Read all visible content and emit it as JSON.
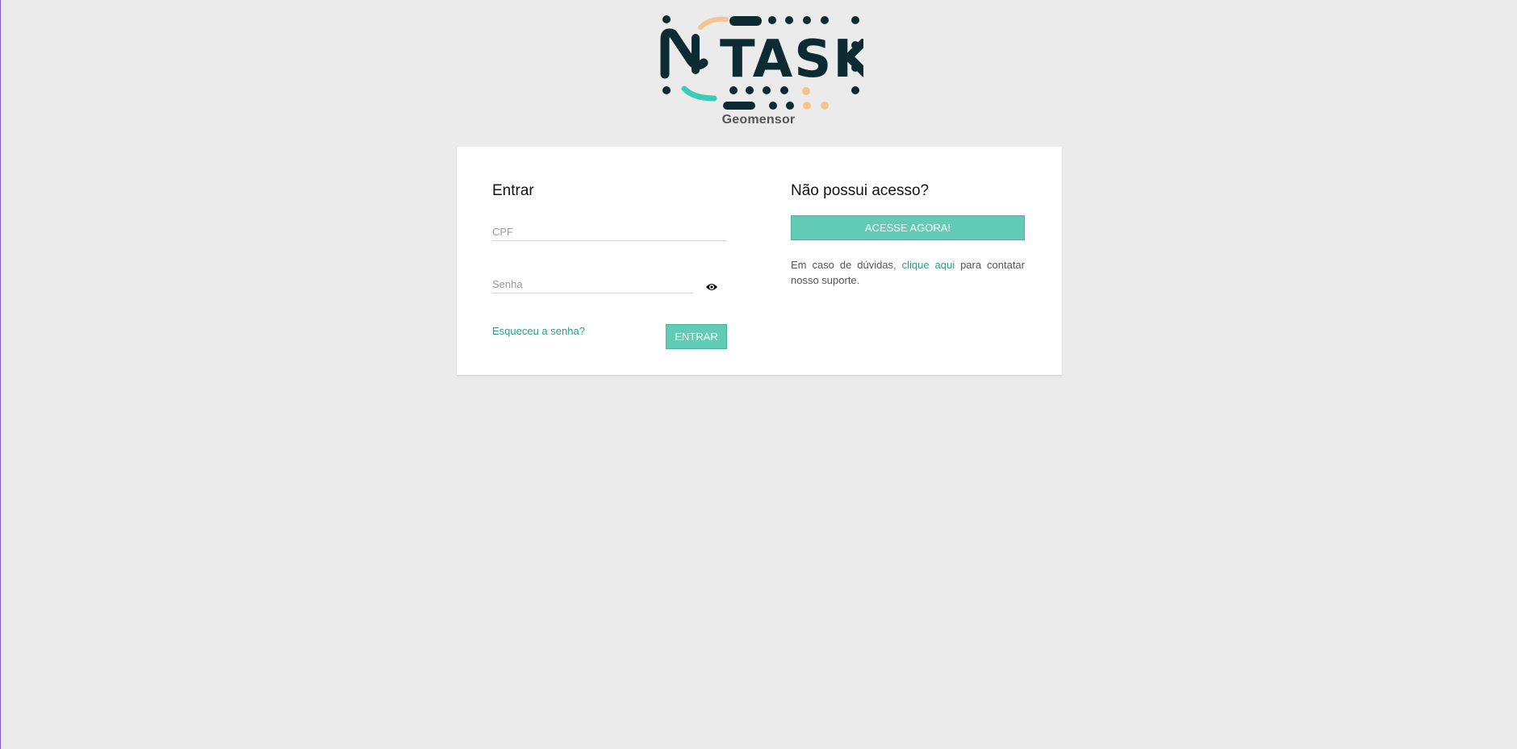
{
  "brand": {
    "logo_text": "NTASK",
    "subtitle": "Geomensor"
  },
  "login": {
    "title": "Entrar",
    "cpf_placeholder": "CPF",
    "senha_placeholder": "Senha",
    "forgot_label": "Esqueceu a senha?",
    "submit_label": "ENTRAR"
  },
  "signup": {
    "title": "Não possui acesso?",
    "cta_label": "ACESSE AGORA!",
    "help_prefix": "Em caso de dúvidas,",
    "help_link": "clique aqui",
    "help_suffix": "para contatar nosso suporte."
  },
  "icons": {
    "password_toggle": "eye-icon"
  },
  "colors": {
    "background": "#ebebeb",
    "accent": "#62cbb5",
    "link": "#2e9e83",
    "logo_dark": "#0d2b33",
    "logo_teal": "#3ccbb3",
    "logo_peach": "#f5c48e"
  }
}
